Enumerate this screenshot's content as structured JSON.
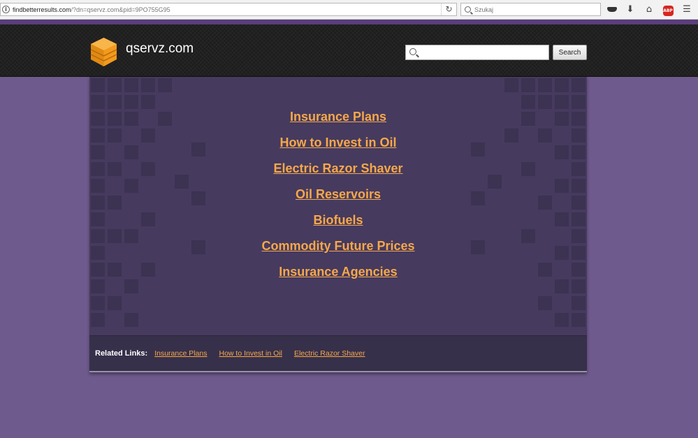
{
  "browser": {
    "url_host": "findbetterresults.com",
    "url_path": "/?dn=qservz.com&pid=9PO755G95",
    "search_placeholder": "Szukaj",
    "abp_label": "ABP"
  },
  "site": {
    "name": "qservz.com",
    "search_button_label": "Search",
    "search_value": ""
  },
  "main": {
    "links": [
      "Insurance Plans",
      "How to Invest in Oil",
      "Electric Razor Shaver",
      "Oil Reservoirs",
      "Biofuels",
      "Commodity Future Prices",
      "Insurance Agencies"
    ]
  },
  "related": {
    "label": "Related Links:",
    "links": [
      "Insurance Plans",
      "How to Invest in Oil",
      "Electric Razor Shaver"
    ]
  },
  "colors": {
    "page_background": "#6e5a8c",
    "header_background": "#1c1c1c",
    "accent_stripe": "#5a3e7a",
    "panel_background": "#463a5e",
    "related_bar_background": "#37304a",
    "link_color": "#f6a84a",
    "logo_orange": "#f29a1d"
  },
  "icons": {
    "info": "info-icon",
    "reload": "reload-icon",
    "browser_search": "search-icon",
    "private": "mask-icon",
    "download": "download-icon",
    "home": "home-icon",
    "adblock": "adblock-icon",
    "menu": "hamburger-menu-icon",
    "logo": "stacked-cube-logo-icon",
    "site_search": "search-icon"
  }
}
